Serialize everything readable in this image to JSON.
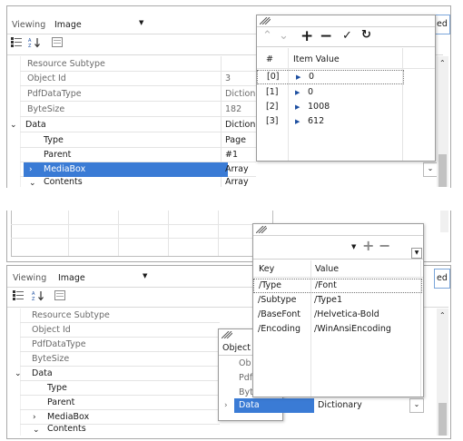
{
  "top": {
    "viewing_label": "Viewing",
    "viewing_value": "Image",
    "right_button_fragment": "ed",
    "properties": [
      {
        "label": "Resource Subtype",
        "value": ""
      },
      {
        "label": "Object Id",
        "value": "3"
      },
      {
        "label": "PdfDataType",
        "value": "Diction"
      },
      {
        "label": "ByteSize",
        "value": "182"
      },
      {
        "label": "Data",
        "value": "Diction"
      },
      {
        "label": "Type",
        "value": "Page"
      },
      {
        "label": "Parent",
        "value": "#1"
      },
      {
        "label": "MediaBox",
        "value": "Array"
      },
      {
        "label": "Contents",
        "value": "Array"
      }
    ],
    "array_popup": {
      "col_index": "#",
      "col_value": "Item Value",
      "items": [
        {
          "index": "[0]",
          "value": "0"
        },
        {
          "index": "[1]",
          "value": "0"
        },
        {
          "index": "[2]",
          "value": "1008"
        },
        {
          "index": "[3]",
          "value": "612"
        }
      ]
    }
  },
  "bottom": {
    "viewing_label": "Viewing",
    "viewing_value": "Image",
    "right_button_fragment": "ed",
    "properties": [
      {
        "label": "Resource Subtype"
      },
      {
        "label": "Object Id"
      },
      {
        "label": "PdfDataType"
      },
      {
        "label": "ByteSize"
      },
      {
        "label": "Data"
      },
      {
        "label": "Type"
      },
      {
        "label": "Parent"
      },
      {
        "label": "MediaBox"
      },
      {
        "label": "Contents"
      }
    ],
    "small_popup": {
      "title_fragment": "Object",
      "rows": [
        "Ob",
        "Pdf",
        "Byt"
      ],
      "data_label": "Data",
      "data_value": "Dictionary"
    },
    "dict_popup": {
      "col_key": "Key",
      "col_value": "Value",
      "entries": [
        {
          "key": "/Type",
          "value": "/Font"
        },
        {
          "key": "/Subtype",
          "value": "/Type1"
        },
        {
          "key": "/BaseFont",
          "value": "/Helvetica-Bold"
        },
        {
          "key": "/Encoding",
          "value": "/WinAnsiEncoding"
        }
      ]
    }
  }
}
